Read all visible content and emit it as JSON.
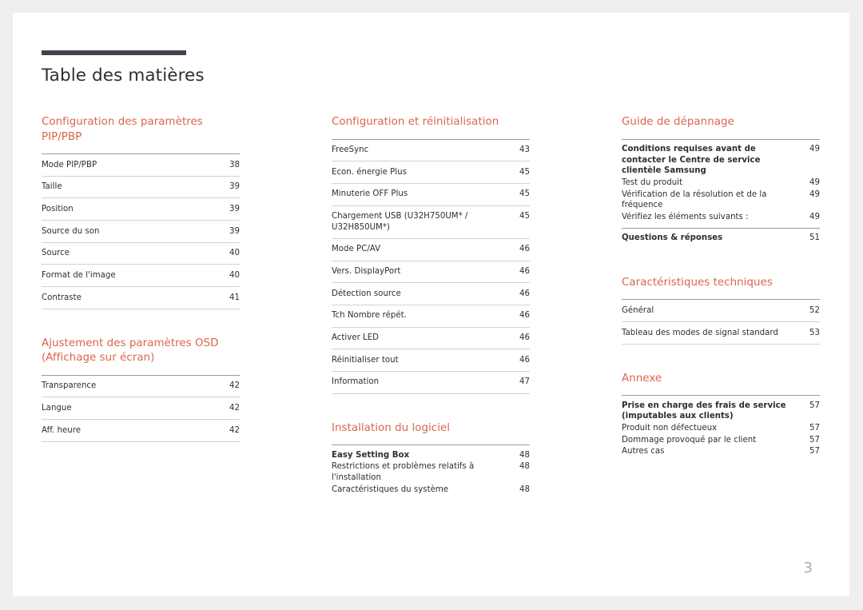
{
  "document": {
    "title": "Table des matières",
    "page_number": "3",
    "accent_color": "#d9664b",
    "rule_color": "#42424f",
    "text_color": "#2e2e36",
    "page_number_color": "#a9adb3",
    "background_color": "#efefef",
    "page_color": "#ffffff"
  },
  "columns": [
    {
      "sections": [
        {
          "heading": "Configuration des paramètres PIP/PBP",
          "entries": [
            {
              "label": "Mode PIP/PBP",
              "page": "38",
              "level": "main"
            },
            {
              "label": "Taille",
              "page": "39",
              "level": "main"
            },
            {
              "label": "Position",
              "page": "39",
              "level": "main"
            },
            {
              "label": "Source du son",
              "page": "39",
              "level": "main"
            },
            {
              "label": "Source",
              "page": "40",
              "level": "main"
            },
            {
              "label": "Format de l'image",
              "page": "40",
              "level": "main"
            },
            {
              "label": "Contraste",
              "page": "41",
              "level": "main"
            }
          ]
        },
        {
          "heading": "Ajustement des paramètres OSD (Affichage sur écran)",
          "entries": [
            {
              "label": "Transparence",
              "page": "42",
              "level": "main"
            },
            {
              "label": "Langue",
              "page": "42",
              "level": "main"
            },
            {
              "label": "Aff. heure",
              "page": "42",
              "level": "main"
            }
          ]
        }
      ]
    },
    {
      "sections": [
        {
          "heading": "Configuration et réinitialisation",
          "entries": [
            {
              "label": "FreeSync",
              "page": "43",
              "level": "main"
            },
            {
              "label": "Econ. énergie Plus",
              "page": "45",
              "level": "main"
            },
            {
              "label": "Minuterie OFF Plus",
              "page": "45",
              "level": "main"
            },
            {
              "label": "Chargement USB (U32H750UM* / U32H850UM*)",
              "page": "45",
              "level": "main"
            },
            {
              "label": "Mode PC/AV",
              "page": "46",
              "level": "main"
            },
            {
              "label": "Vers. DisplayPort",
              "page": "46",
              "level": "main"
            },
            {
              "label": "Détection source",
              "page": "46",
              "level": "main"
            },
            {
              "label": "Tch Nombre répét.",
              "page": "46",
              "level": "main"
            },
            {
              "label": "Activer LED",
              "page": "46",
              "level": "main"
            },
            {
              "label": "Réinitialiser tout",
              "page": "46",
              "level": "main"
            },
            {
              "label": "Information",
              "page": "47",
              "level": "main"
            }
          ]
        },
        {
          "heading": "Installation du logiciel",
          "groups": [
            {
              "rule_after": false,
              "entries": [
                {
                  "label": "Easy Setting Box",
                  "page": "48",
                  "bold": true
                },
                {
                  "label": "Restrictions et problèmes relatifs à l'installation",
                  "page": "48",
                  "bold": false
                },
                {
                  "label": "Caractéristiques du système",
                  "page": "48",
                  "bold": false
                }
              ]
            }
          ]
        }
      ]
    },
    {
      "sections": [
        {
          "heading": "Guide de dépannage",
          "groups": [
            {
              "rule_after": true,
              "entries": [
                {
                  "label": "Conditions requises avant de contacter le Centre de service clientèle Samsung",
                  "page": "49",
                  "bold": true
                },
                {
                  "label": "Test du produit",
                  "page": "49",
                  "bold": false
                },
                {
                  "label": "Vérification de la résolution et de la fréquence",
                  "page": "49",
                  "bold": false
                },
                {
                  "label": "Vérifiez les éléments suivants :",
                  "page": "49",
                  "bold": false
                }
              ]
            },
            {
              "rule_after": false,
              "entries": [
                {
                  "label": "Questions & réponses",
                  "page": "51",
                  "bold": true
                }
              ]
            }
          ]
        },
        {
          "heading": "Caractéristiques techniques",
          "entries": [
            {
              "label": "Général",
              "page": "52",
              "level": "main"
            },
            {
              "label": "Tableau des modes de signal standard",
              "page": "53",
              "level": "main"
            }
          ]
        },
        {
          "heading": "Annexe",
          "groups": [
            {
              "rule_after": false,
              "entries": [
                {
                  "label": "Prise en charge des frais de service (imputables aux clients)",
                  "page": "57",
                  "bold": true
                },
                {
                  "label": "Produit non défectueux",
                  "page": "57",
                  "bold": false
                },
                {
                  "label": "Dommage provoqué par le client",
                  "page": "57",
                  "bold": false
                },
                {
                  "label": "Autres cas",
                  "page": "57",
                  "bold": false
                }
              ]
            }
          ]
        }
      ]
    }
  ]
}
